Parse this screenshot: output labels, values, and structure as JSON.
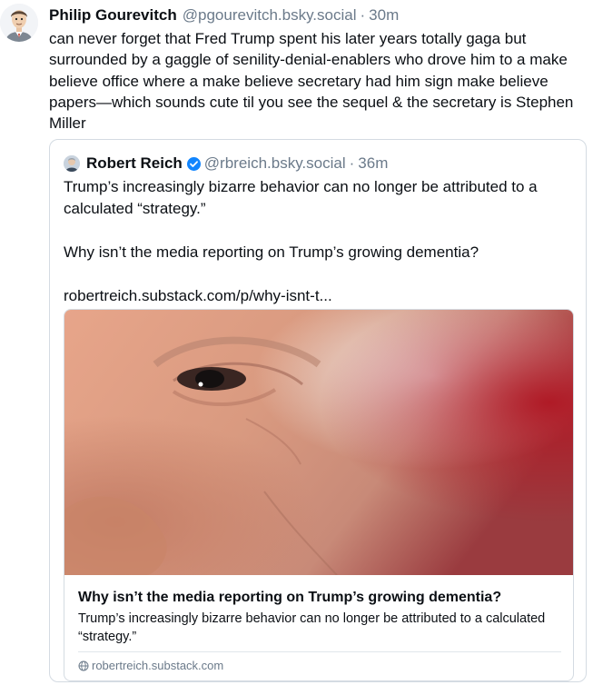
{
  "post": {
    "author_name": "Philip Gourevitch",
    "author_handle": "@pgourevitch.bsky.social",
    "separator": "·",
    "time": "30m",
    "text": "can never forget that Fred Trump spent his later years totally gaga but surrounded by a gaggle of senility-denial-enablers who drove him to a make believe office where a make believe secretary had him sign make believe papers—which sounds cute til you see the sequel & the secretary is Stephen Miller"
  },
  "quote": {
    "author_name": "Robert Reich",
    "author_handle": "@rbreich.bsky.social",
    "separator": "·",
    "time": "36m",
    "line1": "Trump’s increasingly bizarre behavior can no longer be attributed to a calculated “strategy.”",
    "line2": "Why isn’t the media reporting on Trump’s growing dementia?",
    "link": "robertreich.substack.com/p/why-isnt-t...",
    "card": {
      "title": "Why isn’t the media reporting on Trump’s growing dementia?",
      "description": "Trump’s increasingly bizarre behavior can no longer be attributed to a calculated “strategy.”",
      "domain": "robertreich.substack.com"
    }
  },
  "icons": {
    "verified": "verified-check-icon",
    "globe": "globe-icon"
  },
  "colors": {
    "text": "#0b0f14",
    "muted": "#6b7a8a",
    "verified": "#1185fe",
    "border": "#d4dbe2"
  }
}
